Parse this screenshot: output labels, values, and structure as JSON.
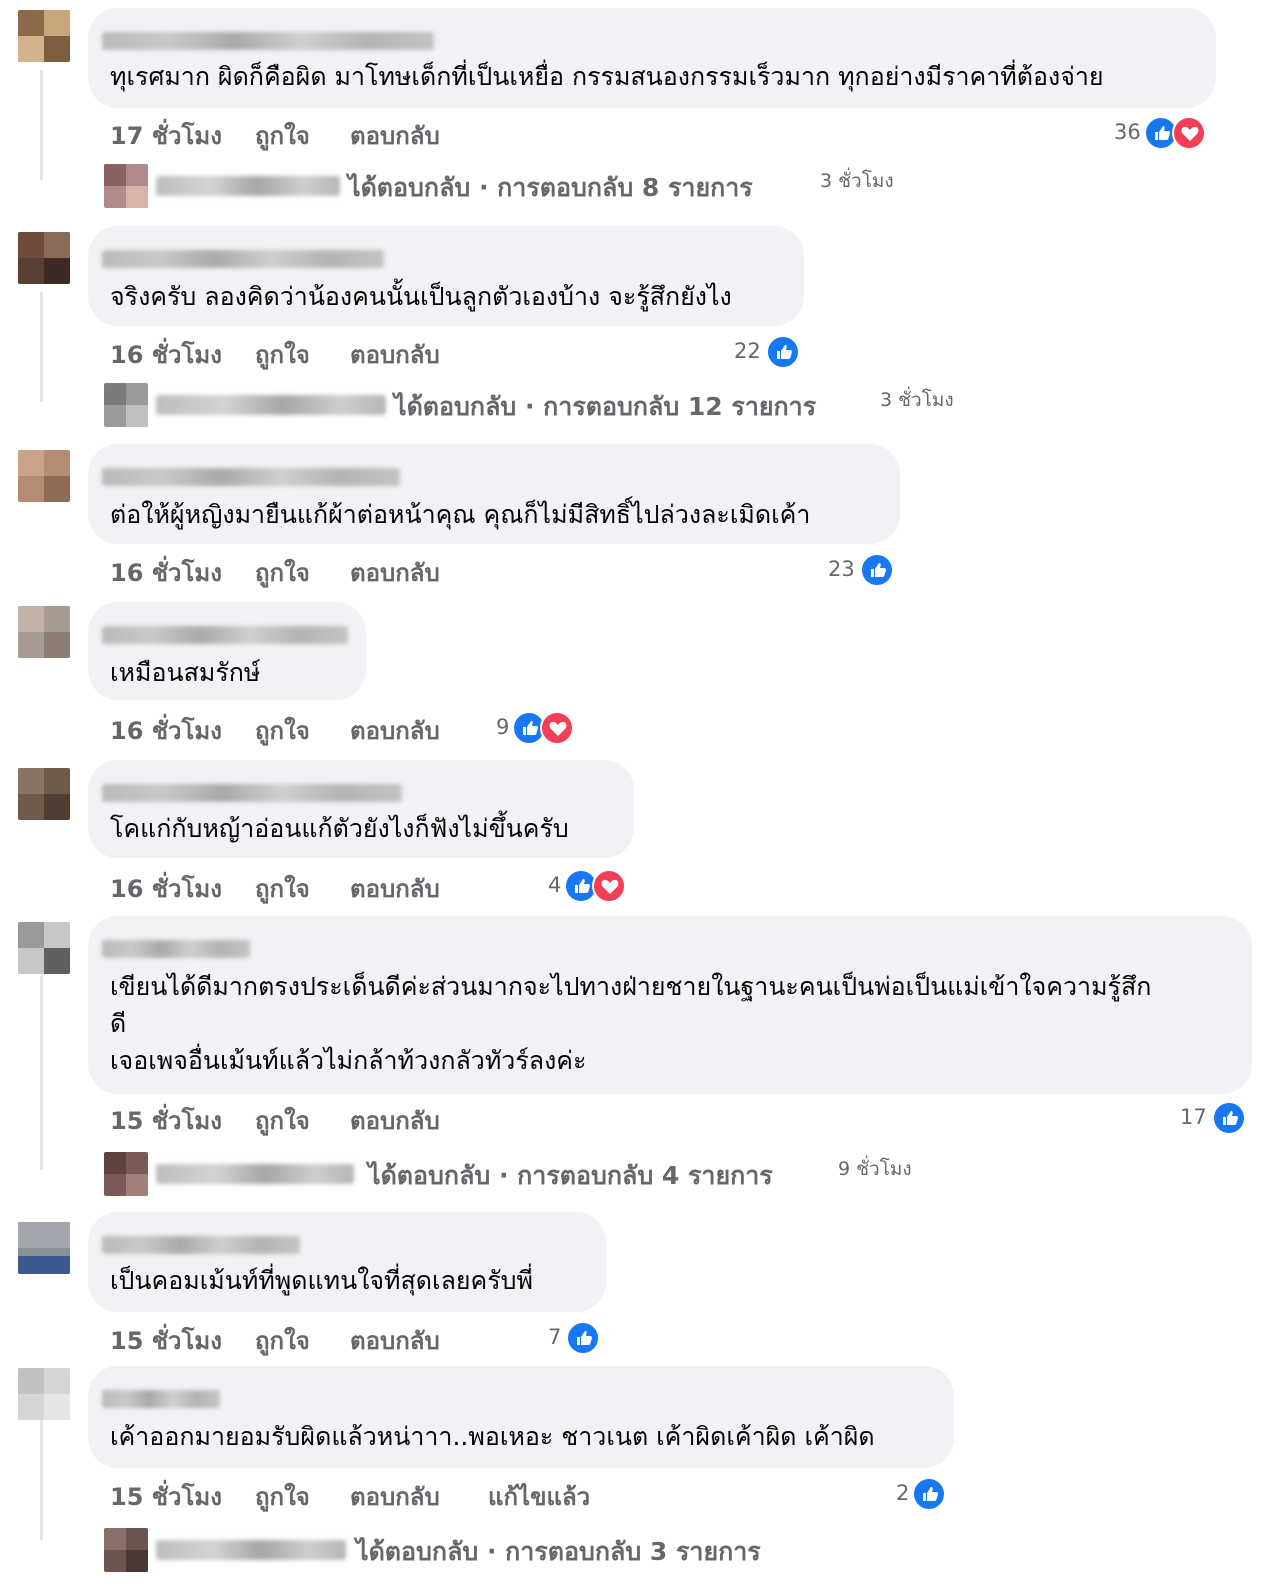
{
  "labels": {
    "like": "ถูกใจ",
    "reply": "ตอบกลับ",
    "edited": "แก้ไขแล้ว"
  },
  "comments": [
    {
      "text": "ทุเรศมาก ผิดก็คือผิด มาโทษเด็กที่เป็นเหยื่อ กรรมสนองกรรมเร็วมาก ทุกอย่างมีราคาที่ต้องจ่าย",
      "time": "17 ชั่วโมง",
      "count": "36",
      "reactions": [
        "like-icon",
        "love-icon"
      ],
      "replies": {
        "text": "ได้ตอบกลับ · การตอบกลับ 8 รายการ",
        "time": "3 ชั่วโมง"
      }
    },
    {
      "text": "จริงครับ ลองคิดว่าน้องคนนั้นเป็นลูกตัวเองบ้าง จะรู้สึกยังไง",
      "time": "16 ชั่วโมง",
      "count": "22",
      "reactions": [
        "like-icon"
      ],
      "replies": {
        "text": "ได้ตอบกลับ · การตอบกลับ 12 รายการ",
        "time": "3 ชั่วโมง"
      }
    },
    {
      "text": "ต่อให้ผู้หญิงมายืนแก้ผ้าต่อหน้าคุณ คุณก็ไม่มีสิทธิ์ไปล่วงละเมิดเค้า",
      "time": "16 ชั่วโมง",
      "count": "23",
      "reactions": [
        "like-icon"
      ]
    },
    {
      "text": "เหมือนสมรักษ์",
      "time": "16 ชั่วโมง",
      "count": "9",
      "reactions": [
        "like-icon",
        "love-icon"
      ]
    },
    {
      "text": "โคแก่กับหญ้าอ่อนแก้ตัวยังไงก็ฟังไม่ขึ้นครับ",
      "time": "16 ชั่วโมง",
      "count": "4",
      "reactions": [
        "like-icon",
        "love-icon"
      ]
    },
    {
      "text": "เขียนได้ดีมากตรงประเด็นดีค่ะส่วนมากจะไปทางฝ่ายชายในฐานะคนเป็นพ่อเป็นแม่เข้าใจความรู้สึก\nดี\nเจอเพจอื่นเม้นท์แล้วไม่กล้าท้วงกลัวทัวร์ลงค่ะ",
      "time": "15 ชั่วโมง",
      "count": "17",
      "reactions": [
        "like-icon"
      ],
      "replies": {
        "text": "ได้ตอบกลับ · การตอบกลับ 4 รายการ",
        "time": "9 ชั่วโมง"
      }
    },
    {
      "text": "เป็นคอมเม้นท์ที่พูดแทนใจที่สุดเลยครับพี่",
      "time": "15 ชั่วโมง",
      "count": "7",
      "reactions": [
        "like-icon"
      ]
    },
    {
      "text": "เค้าออกมายอมรับผิดแล้วหน่าาา..พอเหอะ ชาวเนต เค้าผิดเค้าผิด เค้าผิด",
      "time": "15 ชั่วโมง",
      "count": "2",
      "reactions": [
        "like-icon"
      ],
      "edited": true,
      "replies": {
        "text": "ได้ตอบกลับ · การตอบกลับ 3 รายการ",
        "time": ""
      }
    }
  ],
  "colors": {
    "bubble": "#f0f2f5",
    "meta": "#65676b",
    "like": "#1877f2",
    "love": "#f33e58"
  }
}
